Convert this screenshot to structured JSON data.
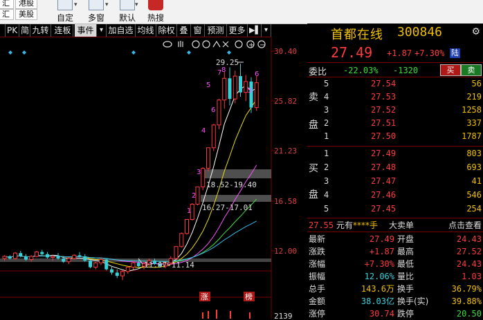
{
  "toolbar": {
    "left_buttons": [
      "港股",
      "美股"
    ],
    "big_buttons": [
      {
        "label": "自定",
        "icon": "custom-icon"
      },
      {
        "label": "多窗",
        "icon": "multi-window-icon"
      },
      {
        "label": "默认",
        "icon": "default-icon"
      },
      {
        "label": "热搜",
        "icon": "hot-search-icon"
      }
    ]
  },
  "subbar": {
    "items": [
      "PK",
      "简",
      "九转",
      "连板",
      "事件",
      "加自选",
      "均线",
      "除权",
      "叠",
      "窗",
      "预测",
      "更多"
    ],
    "active_index": 4
  },
  "chart": {
    "price_axis": [
      "30.40",
      "25.82",
      "21.23",
      "16.58",
      "12.00"
    ],
    "indicator_axis": "2139",
    "annotations": {
      "high": "29.25",
      "zone1": "18.52-19.40",
      "zone2": "16.27-17.01",
      "low_zone": "11.07-11.14"
    },
    "up_badge": "涨",
    "rank_badge": "榜",
    "candles": [
      [
        11.3,
        11.6,
        11.1,
        11.5
      ],
      [
        11.5,
        11.6,
        11.2,
        11.3
      ],
      [
        11.3,
        11.9,
        11.2,
        11.8
      ],
      [
        11.8,
        12.0,
        11.4,
        11.5
      ],
      [
        11.5,
        11.7,
        11.1,
        11.2
      ],
      [
        11.2,
        11.6,
        11.0,
        11.5
      ],
      [
        11.5,
        12.0,
        11.4,
        11.9
      ],
      [
        11.9,
        12.1,
        11.6,
        11.7
      ],
      [
        11.7,
        11.9,
        11.3,
        11.4
      ],
      [
        11.4,
        11.6,
        11.1,
        11.5
      ],
      [
        11.5,
        11.8,
        11.2,
        11.3
      ],
      [
        11.3,
        11.5,
        10.9,
        11.0
      ],
      [
        11.0,
        11.4,
        10.8,
        11.3
      ],
      [
        11.3,
        11.7,
        11.2,
        11.6
      ],
      [
        11.6,
        11.9,
        11.4,
        11.5
      ],
      [
        11.5,
        11.7,
        11.0,
        11.1
      ],
      [
        11.1,
        11.2,
        10.4,
        10.5
      ],
      [
        10.5,
        11.0,
        10.3,
        10.9
      ],
      [
        10.9,
        11.4,
        10.7,
        11.2
      ],
      [
        11.2,
        11.3,
        10.2,
        10.3
      ],
      [
        10.3,
        10.6,
        9.8,
        10.0
      ],
      [
        10.0,
        10.3,
        9.5,
        9.7
      ],
      [
        9.7,
        10.2,
        9.3,
        10.1
      ],
      [
        10.1,
        10.6,
        9.9,
        10.5
      ],
      [
        10.5,
        11.1,
        10.3,
        10.9
      ],
      [
        10.9,
        11.2,
        10.4,
        10.6
      ],
      [
        10.6,
        11.0,
        10.3,
        10.8
      ],
      [
        10.8,
        11.3,
        10.6,
        11.1
      ],
      [
        11.1,
        11.3,
        10.7,
        10.8
      ],
      [
        10.8,
        11.0,
        10.5,
        10.6
      ],
      [
        10.6,
        11.0,
        10.4,
        10.9
      ],
      [
        10.9,
        11.5,
        10.7,
        11.3
      ],
      [
        11.3,
        12.4,
        11.2,
        12.4
      ],
      [
        12.4,
        13.7,
        12.3,
        13.6
      ],
      [
        13.6,
        14.9,
        13.5,
        14.9
      ],
      [
        14.9,
        16.4,
        14.8,
        16.3
      ],
      [
        16.3,
        17.9,
        16.2,
        17.9
      ],
      [
        17.9,
        19.7,
        17.6,
        19.6
      ],
      [
        19.6,
        21.5,
        19.3,
        21.5
      ],
      [
        21.5,
        23.7,
        21.2,
        23.6
      ],
      [
        23.6,
        26.0,
        23.2,
        25.9
      ],
      [
        25.9,
        28.5,
        25.1,
        27.9
      ],
      [
        27.9,
        28.9,
        25.4,
        26.0
      ],
      [
        26.0,
        28.6,
        25.6,
        28.1
      ],
      [
        28.1,
        29.25,
        26.2,
        26.6
      ],
      [
        26.6,
        28.2,
        25.8,
        27.6
      ],
      [
        27.6,
        28.0,
        24.7,
        25.2
      ],
      [
        25.2,
        28.1,
        24.9,
        27.49
      ]
    ]
  },
  "quote": {
    "name": "首都在线",
    "code": "300846",
    "price": "27.49",
    "change": "+1.87",
    "pct": "+7.30%",
    "badge": "陆",
    "weibi_label": "委比",
    "weibi_pct": "-22.03%",
    "weicha": "-1320",
    "buy_label": "买",
    "sell_label": "卖",
    "ask_side": "卖盘",
    "bid_side": "买盘",
    "asks": [
      {
        "lvl": "5",
        "price": "27.54",
        "vol": "56"
      },
      {
        "lvl": "4",
        "price": "27.53",
        "vol": "219"
      },
      {
        "lvl": "3",
        "price": "27.52",
        "vol": "1258"
      },
      {
        "lvl": "2",
        "price": "27.51",
        "vol": "337"
      },
      {
        "lvl": "1",
        "price": "27.50",
        "vol": "1787"
      }
    ],
    "bids": [
      {
        "lvl": "1",
        "price": "27.49",
        "vol": "803"
      },
      {
        "lvl": "2",
        "price": "27.48",
        "vol": "693"
      },
      {
        "lvl": "3",
        "price": "27.47",
        "vol": "41"
      },
      {
        "lvl": "4",
        "price": "27.46",
        "vol": "546"
      },
      {
        "lvl": "5",
        "price": "27.45",
        "vol": "254"
      }
    ],
    "trade": {
      "price": "27.55",
      "unit": "元有",
      "hand": "****手",
      "big_order": "大卖单",
      "click_view": "点击查看"
    },
    "stats": [
      {
        "k1": "最新",
        "v1": "27.49",
        "k2": "开盘",
        "v2": "24.43"
      },
      {
        "k1": "涨跌",
        "v1": "+1.87",
        "k2": "最高",
        "v2": "27.52"
      },
      {
        "k1": "涨幅",
        "v1": "+7.30%",
        "k2": "最低",
        "v2": "24.43"
      },
      {
        "k1": "振幅",
        "v1": "12.06%",
        "k2": "量比",
        "v2": "1.03"
      },
      {
        "k1": "总手",
        "v1": "143.6万",
        "k2": "换手",
        "v2": "36.79%"
      },
      {
        "k1": "金额",
        "v1": "38.03亿",
        "k2": "换手(实)",
        "v2": "39.88%"
      },
      {
        "k1": "涨停",
        "v1": "30.74",
        "k2": "跌停",
        "v2": "20.50"
      }
    ]
  },
  "colors": {
    "up": "#ff3b3b",
    "down": "#38d0d8",
    "accent": "#f0c000",
    "border": "#7a0000"
  }
}
